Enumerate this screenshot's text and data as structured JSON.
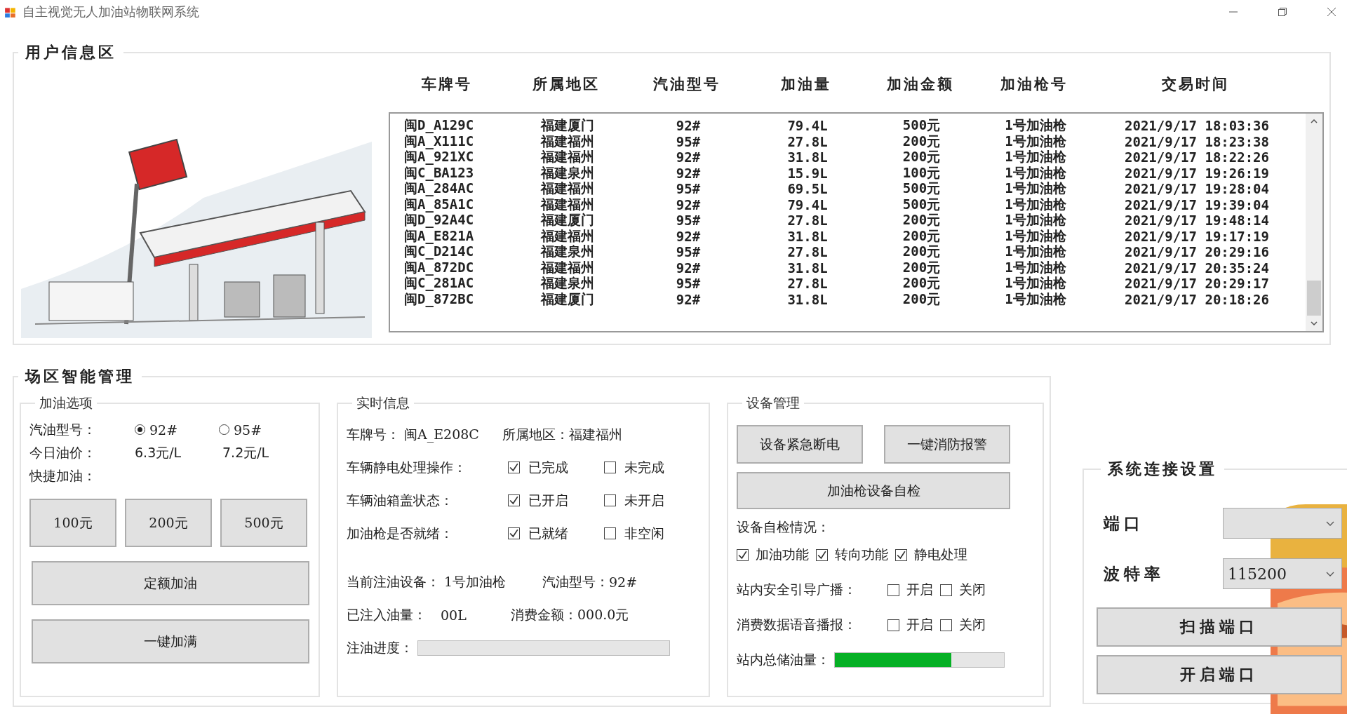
{
  "window": {
    "title": "自主视觉无人加油站物联网系统"
  },
  "user_info": {
    "title": "用户信息区",
    "table": {
      "columns": [
        "车牌号",
        "所属地区",
        "汽油型号",
        "加油量",
        "加油金额",
        "加油枪号",
        "交易时间"
      ],
      "rows": [
        [
          "闽D_A129C",
          "福建厦门",
          "92#",
          "79.4L",
          "500元",
          "1号加油枪",
          "2021/9/17 18:03:36"
        ],
        [
          "闽A_X111C",
          "福建福州",
          "95#",
          "27.8L",
          "200元",
          "1号加油枪",
          "2021/9/17 18:23:38"
        ],
        [
          "闽A_921XC",
          "福建福州",
          "92#",
          "31.8L",
          "200元",
          "1号加油枪",
          "2021/9/17 18:22:26"
        ],
        [
          "闽C_BA123",
          "福建泉州",
          "92#",
          "15.9L",
          "100元",
          "1号加油枪",
          "2021/9/17 19:26:19"
        ],
        [
          "闽A_284AC",
          "福建福州",
          "95#",
          "69.5L",
          "500元",
          "1号加油枪",
          "2021/9/17 19:28:04"
        ],
        [
          "闽A_85A1C",
          "福建福州",
          "92#",
          "79.4L",
          "500元",
          "1号加油枪",
          "2021/9/17 19:39:04"
        ],
        [
          "闽D_92A4C",
          "福建厦门",
          "95#",
          "27.8L",
          "200元",
          "1号加油枪",
          "2021/9/17 19:48:14"
        ],
        [
          "闽A_E821A",
          "福建福州",
          "92#",
          "31.8L",
          "200元",
          "1号加油枪",
          "2021/9/17 19:17:19"
        ],
        [
          "闽C_D214C",
          "福建泉州",
          "95#",
          "27.8L",
          "200元",
          "1号加油枪",
          "2021/9/17 20:29:16"
        ],
        [
          "闽A_872DC",
          "福建福州",
          "92#",
          "31.8L",
          "200元",
          "1号加油枪",
          "2021/9/17 20:35:24"
        ],
        [
          "闽C_281AC",
          "福建泉州",
          "95#",
          "27.8L",
          "200元",
          "1号加油枪",
          "2021/9/17 20:29:17"
        ],
        [
          "闽D_872BC",
          "福建厦门",
          "92#",
          "31.8L",
          "200元",
          "1号加油枪",
          "2021/9/17 20:18:26"
        ]
      ]
    }
  },
  "site_management": {
    "title": "场区智能管理",
    "fuel_options": {
      "title": "加油选项",
      "fuel_type_label": "汽油型号：",
      "fuel_types": [
        {
          "label": "92#",
          "selected": true
        },
        {
          "label": "95#",
          "selected": false
        }
      ],
      "price_label": "今日油价：",
      "prices": [
        "6.3元/L",
        "7.2元/L"
      ],
      "quick_label": "快捷加油：",
      "quick_buttons": [
        "100元",
        "200元",
        "500元"
      ],
      "buttons": [
        "定额加油",
        "一键加满"
      ]
    },
    "realtime": {
      "title": "实时信息",
      "plate_label": "车牌号：",
      "plate": "闽A_E208C",
      "region_label": "所属地区：",
      "region": "福建福州",
      "checks": [
        {
          "label": "车辆静电处理操作：",
          "options": [
            {
              "label": "已完成",
              "checked": true
            },
            {
              "label": "未完成",
              "checked": false
            }
          ]
        },
        {
          "label": "车辆油箱盖状态：",
          "options": [
            {
              "label": "已开启",
              "checked": true
            },
            {
              "label": "未开启",
              "checked": false
            }
          ]
        },
        {
          "label": "加油枪是否就绪：",
          "options": [
            {
              "label": "已就绪",
              "checked": true
            },
            {
              "label": "非空闲",
              "checked": false
            }
          ]
        }
      ],
      "device_label": "当前注油设备：",
      "device": "1号加油枪",
      "fuel_label": "汽油型号：",
      "fuel": "92#",
      "volume_label": "已注入油量：",
      "volume": "00L",
      "cost_label": "消费金额：",
      "cost": "000.0元",
      "progress_label": "注油进度：",
      "progress": {
        "level": 0
      }
    },
    "device": {
      "title": "设备管理",
      "buttons": [
        "设备紧急断电",
        "一键消防报警"
      ],
      "self_test_button": "加油枪设备自检",
      "self_test_label": "设备自检情况：",
      "self_test": [
        {
          "label": "加油功能",
          "checked": true
        },
        {
          "label": "转向功能",
          "checked": true
        },
        {
          "label": "静电处理",
          "checked": true
        }
      ],
      "switches": [
        {
          "label": "站内安全引导广播：",
          "options": [
            {
              "label": "开启",
              "checked": false
            },
            {
              "label": "关闭",
              "checked": false
            }
          ]
        },
        {
          "label": "消费数据语音播报：",
          "options": [
            {
              "label": "开启",
              "checked": false
            },
            {
              "label": "关闭",
              "checked": false
            }
          ]
        }
      ],
      "storage_label": "站内总储油量：",
      "storage": {
        "level": 0.69
      }
    }
  },
  "connection": {
    "title": "系统连接设置",
    "port_label": "端口",
    "baud_label": "波特率",
    "baud": "115200",
    "buttons": [
      "扫描端口",
      "开启端口"
    ]
  }
}
